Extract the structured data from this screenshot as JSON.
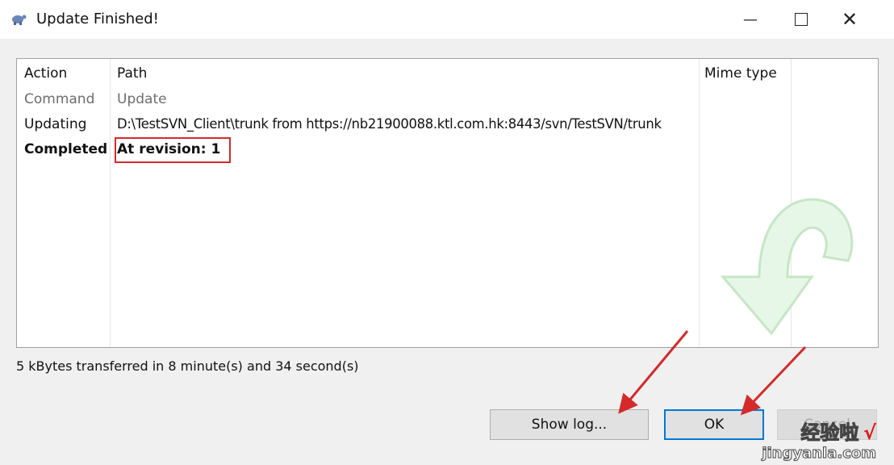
{
  "window": {
    "title": "Update Finished!",
    "icon": "tortoisesvn-icon"
  },
  "window_controls": [
    "minimize-icon",
    "maximize-icon",
    "close-icon"
  ],
  "list": {
    "headers": {
      "action": "Action",
      "path": "Path",
      "mime": "Mime type"
    },
    "rows": [
      {
        "action": "Command",
        "path": "Update",
        "style": "muted"
      },
      {
        "action": "Updating",
        "path": "D:\\TestSVN_Client\\trunk from https://nb21900088.ktl.com.hk:8443/svn/TestSVN/trunk",
        "style": "normal"
      },
      {
        "action": "Completed",
        "path": "At revision: 1",
        "style": "bold"
      }
    ]
  },
  "status": "5 kBytes transferred in 8 minute(s) and 34 second(s)",
  "buttons": {
    "show_log": "Show log...",
    "ok": "OK",
    "cancel": "Cancel"
  },
  "annotation_color": "#d42a2a",
  "watermark": {
    "cn": "经验啦",
    "check": "√",
    "en": "jingyanla.com"
  }
}
